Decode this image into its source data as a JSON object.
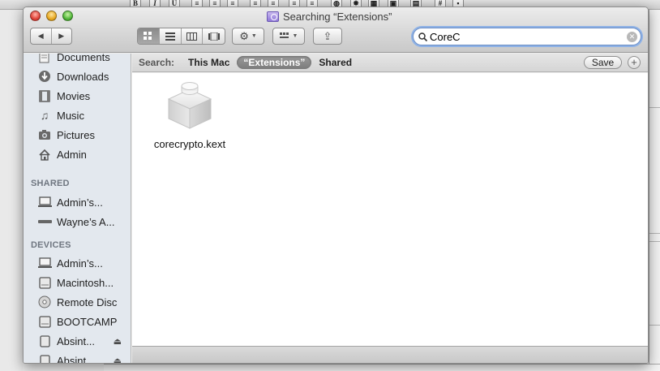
{
  "window": {
    "title": "Searching “Extensions”"
  },
  "toolbar": {
    "back_label": "◀",
    "forward_label": "▶",
    "share_label": "⇪"
  },
  "search": {
    "value": "CoreC",
    "clear_label": "✕"
  },
  "scope": {
    "label": "Search:",
    "options": [
      "This Mac",
      "“Extensions”",
      "Shared"
    ],
    "selected": "“Extensions”",
    "save_label": "Save",
    "add_label": "+"
  },
  "sidebar": {
    "favorites": [
      {
        "label": "Documents",
        "icon": "documents-icon"
      },
      {
        "label": "Downloads",
        "icon": "downloads-icon"
      },
      {
        "label": "Movies",
        "icon": "movies-icon"
      },
      {
        "label": "Music",
        "icon": "music-icon"
      },
      {
        "label": "Pictures",
        "icon": "pictures-icon"
      },
      {
        "label": "Admin",
        "icon": "home-icon"
      }
    ],
    "shared_header": "SHARED",
    "shared": [
      {
        "label": "Admin’s...",
        "icon": "computer-icon"
      },
      {
        "label": "Wayne’s A...",
        "icon": "network-icon"
      }
    ],
    "devices_header": "DEVICES",
    "devices": [
      {
        "label": "Admin’s...",
        "icon": "computer-icon"
      },
      {
        "label": "Macintosh...",
        "icon": "disk-icon"
      },
      {
        "label": "Remote Disc",
        "icon": "disc-icon"
      },
      {
        "label": "BOOTCAMP",
        "icon": "disk-icon"
      },
      {
        "label": "Absint...",
        "icon": "drive-icon",
        "eject": true
      },
      {
        "label": "Absint...",
        "icon": "drive-icon",
        "eject": true
      }
    ]
  },
  "results": [
    {
      "name": "corecrypto.kext",
      "icon": "kext-icon"
    }
  ],
  "colors": {
    "accent": "#6d8fc4",
    "sidebar_bg": "#e3e8ee",
    "selected_scope": "#8a8a8a"
  }
}
